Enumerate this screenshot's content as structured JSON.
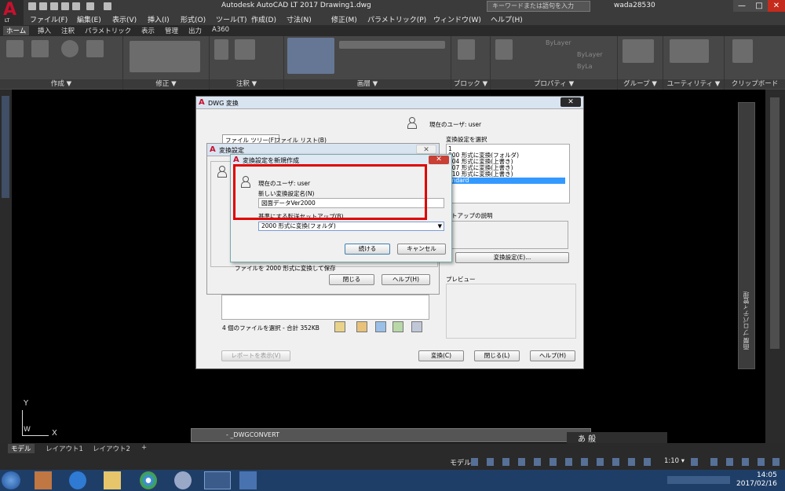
{
  "app": {
    "logo_letters": "A",
    "logo_sub": "LT",
    "title": "Autodesk AutoCAD LT 2017    Drawing1.dwg",
    "search_placeholder": "キーワードまたは語句を入力",
    "username": "wada28530",
    "win_min": "—",
    "win_max": "□",
    "win_close": "✕"
  },
  "menubar": [
    "ファイル(F)",
    "編集(E)",
    "表示(V)",
    "挿入(I)",
    "形式(O)",
    "ツール(T)",
    "作成(D)",
    "寸法(N)",
    "修正(M)",
    "パラメトリック(P)",
    "ウィンドウ(W)",
    "ヘルプ(H)"
  ],
  "tabs": [
    "ホーム",
    "挿入",
    "注釈",
    "パラメトリック",
    "表示",
    "管理",
    "出力",
    "A360"
  ],
  "ribbon": {
    "panels": [
      "作成 ▼",
      "修正 ▼",
      "注釈 ▼",
      "画層 ▼",
      "ブロック ▼",
      "プロパティ ▼",
      "グループ ▼",
      "ユーティリティ ▼",
      "クリップボード"
    ],
    "bylayer1": "ByLayer",
    "bylayer2": "ByLayer",
    "bylayer3": "ByLa"
  },
  "dwg_dialog": {
    "title": "DWG 変換",
    "current_user": "現在のユーザ: user",
    "tab_tree": "ファイル ツリー(F)",
    "tab_list": "ファイル リスト(B)",
    "select_setting_label": "変換設定を選択",
    "settings": [
      "1",
      "000 形式に変換(フォルダ)",
      "004 形式に変換(上書き)",
      "007 形式に変換(上書き)",
      "010 形式に変換(上書き)",
      "andard"
    ],
    "setup_desc_label": "トアップの説明",
    "convert_setting_button": "変換設定(E)...",
    "preview_label": "プレビュー",
    "file_summary": "4 個のファイルを選択 - 合計 352KB",
    "report_button": "レポートを表示(V)",
    "convert_button": "変換(C)",
    "close_button": "閉じる(L)",
    "help_button": "ヘルプ(H)"
  },
  "setup_dialog": {
    "title": "変換設定",
    "desc": "ファイルを 2000 形式に変換して保存",
    "close_button": "閉じる",
    "help_button": "ヘルプ(H)"
  },
  "new_dialog": {
    "title": "変換設定を新規作成",
    "current_user": "現在のユーザ: user",
    "name_label": "新しい変換設定名(N)",
    "name_value": "図面データVer2000",
    "base_label": "基準にする転送セットアップ(B)",
    "base_value": "2000 形式に変換(フォルダ)",
    "continue_button": "続ける",
    "cancel_button": "キャンセル"
  },
  "palette_label": "画層 プロパティ管理",
  "palette_label2": "プロパティ",
  "axis": {
    "y": "Y",
    "x": "X",
    "w": "W"
  },
  "command_line": "- _DWGCONVERT",
  "ime_text": "あ 般",
  "layout_tabs": [
    "モデル",
    "レイアウト1",
    "レイアウト2",
    "+"
  ],
  "status": {
    "model": "モデル",
    "scale": "1:10 ▾"
  },
  "clock": {
    "time": "14:05",
    "date": "2017/02/16"
  }
}
